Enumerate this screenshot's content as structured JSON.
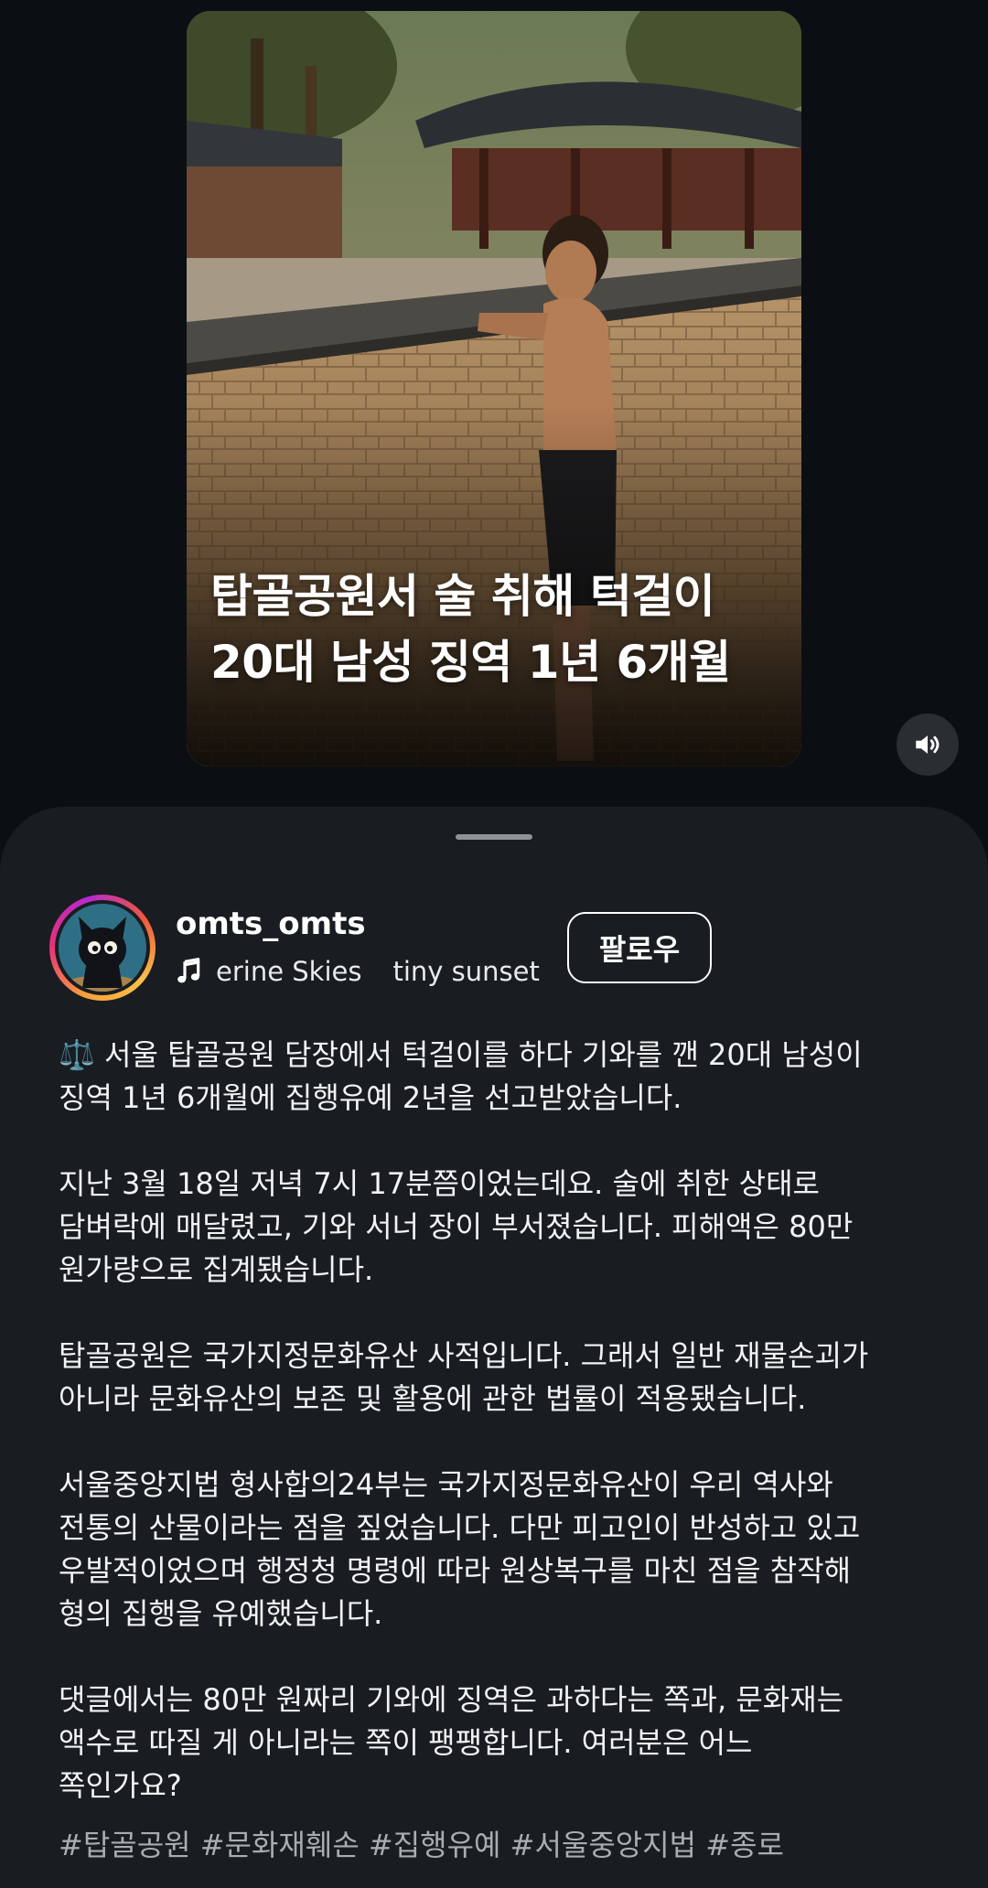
{
  "video": {
    "caption_lines": [
      "탑골공원서 술 취해 턱걸이",
      "20대 남성 징역 1년 6개월"
    ],
    "sound_icon": "speaker-volume-icon"
  },
  "post": {
    "username": "omts_omts",
    "music_icon": "music-note-icon",
    "music_tracks": [
      "erine Skies",
      "tiny sunset"
    ],
    "follow_label": "팔로우",
    "paragraphs": [
      [
        "⚖️ 서울 탑골공원 담장에서 턱걸이를 하다 기와를 깬 20대 남성이",
        "징역 1년 6개월에 집행유예 2년을 선고받았습니다."
      ],
      [
        "지난 3월 18일 저녁 7시 17분쯤이었는데요. 술에 취한 상태로",
        "담벼락에 매달렸고, 기와 서너 장이 부서졌습니다. 피해액은 80만",
        "원가량으로 집계됐습니다."
      ],
      [
        "탑골공원은 국가지정문화유산 사적입니다. 그래서 일반 재물손괴가",
        "아니라 문화유산의 보존 및 활용에 관한 법률이 적용됐습니다."
      ],
      [
        "서울중앙지법 형사합의24부는 국가지정문화유산이 우리 역사와",
        "전통의 산물이라는 점을 짚었습니다. 다만 피고인이 반성하고 있고",
        "우발적이었으며 행정청 명령에 따라 원상복구를 마친 점을 참작해",
        "형의 집행을 유예했습니다."
      ],
      [
        "댓글에서는 80만 원짜리 기와에 징역은 과하다는 쪽과, 문화재는",
        "액수로 따질 게 아니라는 쪽이 팽팽합니다. 여러분은 어느",
        "쪽인가요?"
      ]
    ],
    "hashtags": "#탑골공원 #문화재훼손 #집행유예 #서울중앙지법 #종로"
  },
  "colors": {
    "background": "#0b0f14",
    "sheet": "#191c20",
    "text": "#f2f3f4",
    "hashtag": "#a9adb1"
  }
}
